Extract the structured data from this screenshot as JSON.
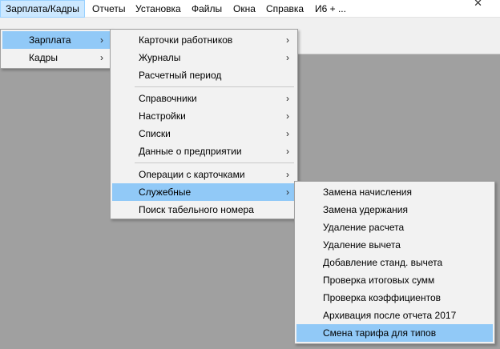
{
  "menubar": {
    "items": [
      {
        "label": "Зарплата/Кадры"
      },
      {
        "label": "Отчеты"
      },
      {
        "label": "Установка"
      },
      {
        "label": "Файлы"
      },
      {
        "label": "Окна"
      },
      {
        "label": "Справка"
      },
      {
        "label": "И6 + ..."
      }
    ]
  },
  "menu_level1": {
    "items": [
      {
        "label": "Зарплата"
      },
      {
        "label": "Кадры"
      }
    ]
  },
  "menu_level2": {
    "items": [
      {
        "label": "Карточки работников"
      },
      {
        "label": "Журналы"
      },
      {
        "label": "Расчетный период"
      },
      {
        "label": "Справочники"
      },
      {
        "label": "Настройки"
      },
      {
        "label": "Списки"
      },
      {
        "label": "Данные о предприятии"
      },
      {
        "label": "Операции с карточками"
      },
      {
        "label": "Служебные"
      },
      {
        "label": "Поиск табельного номера"
      }
    ]
  },
  "menu_level3": {
    "items": [
      {
        "label": "Замена начисления"
      },
      {
        "label": "Замена удержания"
      },
      {
        "label": "Удаление расчета"
      },
      {
        "label": "Удаление вычета"
      },
      {
        "label": "Добавление станд. вычета"
      },
      {
        "label": "Проверка итоговых сумм"
      },
      {
        "label": "Проверка коэффициентов"
      },
      {
        "label": "Архивация после отчета 2017"
      },
      {
        "label": "Смена тарифа для типов"
      }
    ]
  },
  "icons": {
    "submenu_arrow": "chevron-right-icon",
    "close": "close-icon"
  },
  "colors": {
    "highlight": "#91c9f7",
    "menubar_active": "#cce8ff"
  }
}
